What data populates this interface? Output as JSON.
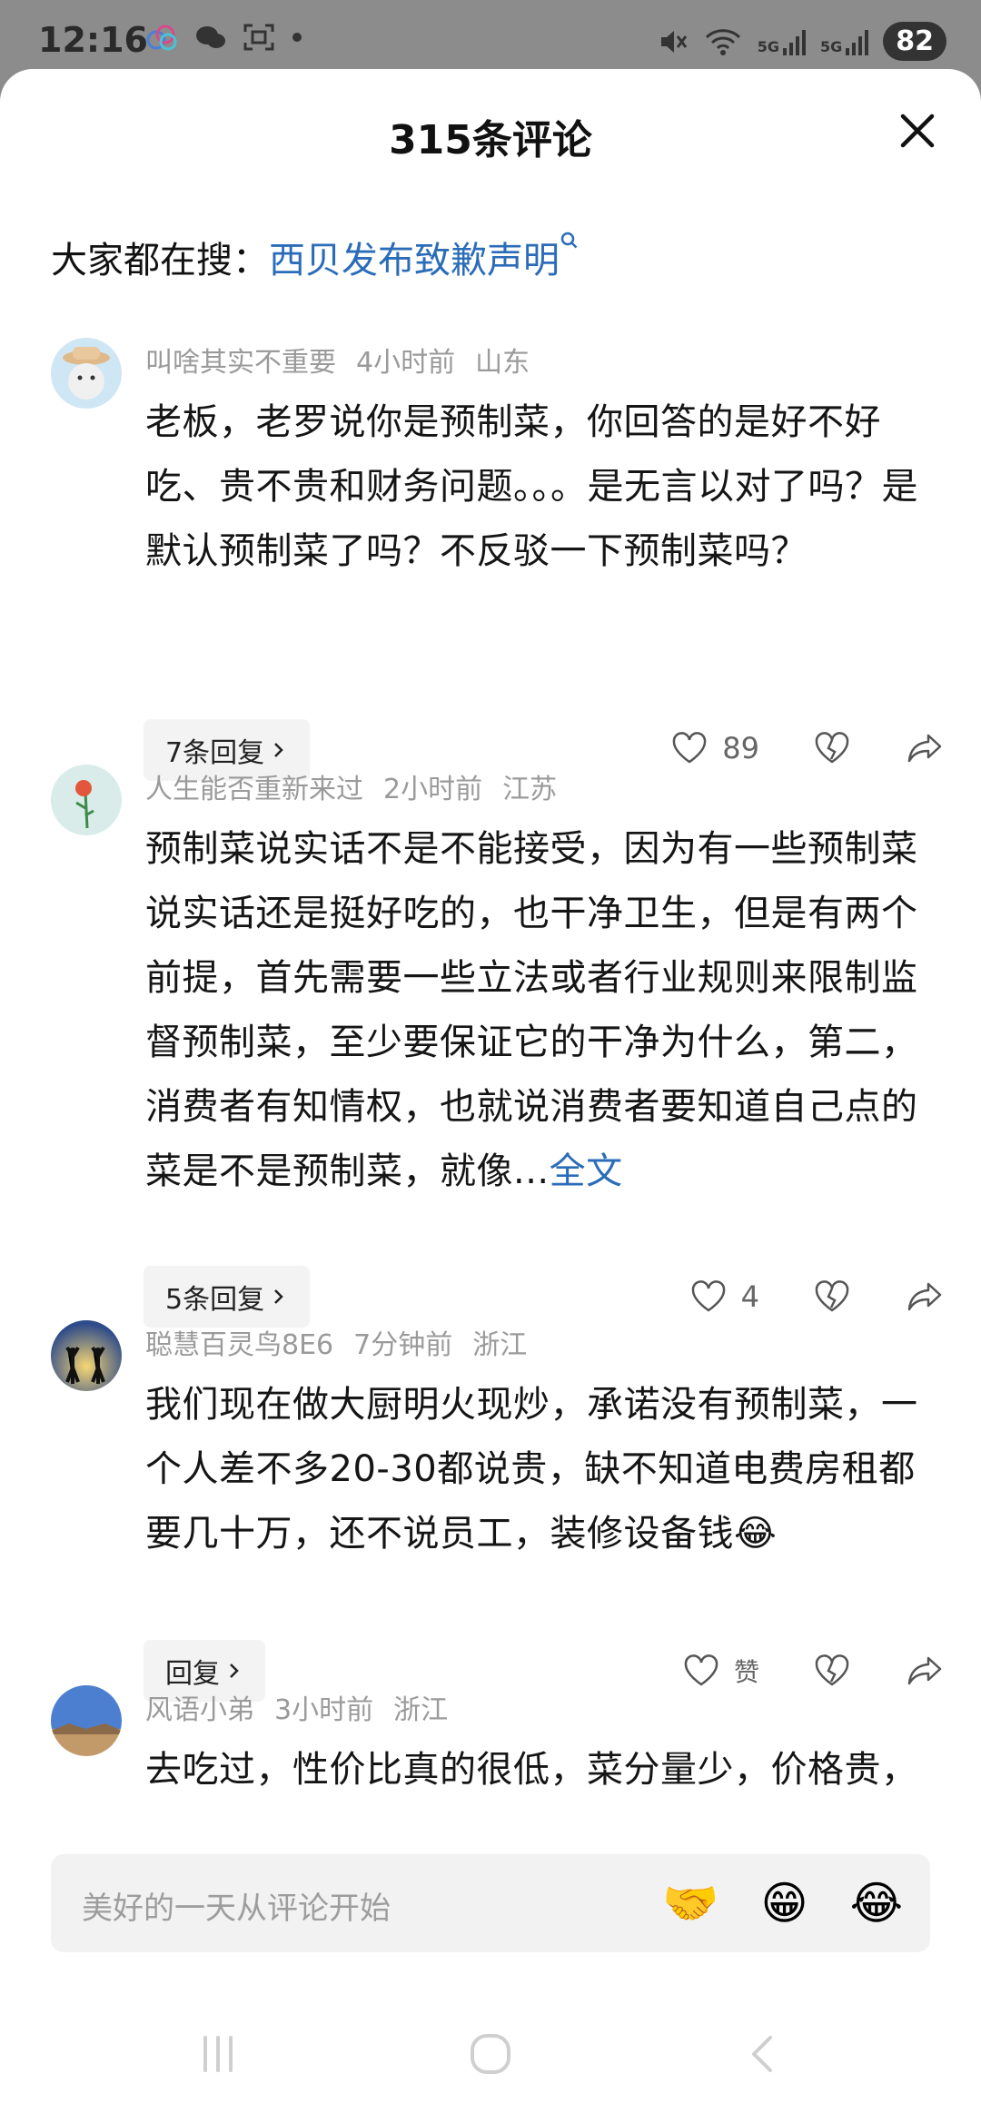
{
  "status_bar": {
    "time": "12:16",
    "left_icons": [
      "cloud-icon",
      "wechat-icon",
      "scan-icon",
      "dot-icon"
    ],
    "right_icons": [
      "mute-icon",
      "wifi-icon",
      "signal-5g-icon",
      "signal-5g-icon"
    ],
    "signal_label": "5G",
    "battery": "82"
  },
  "sheet": {
    "title": "315条评论",
    "search_prefix": "大家都在搜：",
    "search_term": "西贝发布致歉声明"
  },
  "comments": [
    {
      "user": "叫啥其实不重要",
      "time": "4小时前",
      "location": "山东",
      "text": "老板，老罗说你是预制菜，你回答的是好不好吃、贵不贵和财务问题。。。是无言以对了吗？是默认预制菜了吗？不反驳一下预制菜吗？",
      "more": "",
      "replies": "7条回复",
      "likes": "89"
    },
    {
      "user": "人生能否重新来过",
      "time": "2小时前",
      "location": "江苏",
      "text": "预制菜说实话不是不能接受，因为有一些预制菜说实话还是挺好吃的，也干净卫生，但是有两个前提，首先需要一些立法或者行业规则来限制监督预制菜，至少要保证它的干净为什么，第二，消费者有知情权，也就说消费者要知道自己点的菜是不是预制菜，就像...",
      "more": "全文",
      "replies": "5条回复",
      "likes": "4"
    },
    {
      "user": "聪慧百灵鸟8E6",
      "time": "7分钟前",
      "location": "浙江",
      "text": "我们现在做大厨明火现炒，承诺没有预制菜，一个人差不多20-30都说贵，缺不知道电费房租都要几十万，还不说员工，装修设备钱😂",
      "more": "",
      "replies": "回复",
      "likes": "赞"
    },
    {
      "user": "风语小弟",
      "time": "3小时前",
      "location": "浙江",
      "text": "去吃过，性价比真的很低，菜分量少，价格贵，以后不会再去了",
      "more": "",
      "replies": "",
      "likes": ""
    }
  ],
  "input": {
    "placeholder": "美好的一天从评论开始",
    "emojis": [
      "🤝",
      "😁",
      "😂"
    ]
  },
  "colors": {
    "link": "#2b6cb8",
    "meta": "#9a9a9a",
    "chip_bg": "#f3f3f3",
    "input_bg": "#f2f2f2"
  }
}
